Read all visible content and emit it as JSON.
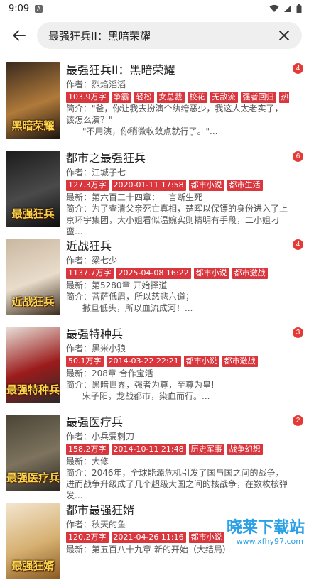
{
  "status_bar": {
    "time": "9:09",
    "notif_icon": "A"
  },
  "search": {
    "query": "最强狂兵II：黑暗荣耀"
  },
  "books": [
    {
      "title": "最强狂兵II：黑暗荣耀",
      "author": "作者：烈焰滔滔",
      "tags": [
        "103.9万字",
        "争霸",
        "轻松",
        "女总裁",
        "校花",
        "无敌流",
        "强者回归",
        "热"
      ],
      "line1": "简介：\"爸，你让我去扮演个纨绔恶少，我这人太老实了，该怎么演？\"",
      "line2": "\"不用演，你稍微收敛点就行了。\"...",
      "badge": "4",
      "cover_text": "黑暗荣耀",
      "cover_colors": [
        "#3b2a1e",
        "#b07a3a",
        "#1a1410"
      ]
    },
    {
      "title": "都市之最强狂兵",
      "author": "作者：江城子七",
      "tags": [
        "127.3万字",
        "2020-01-11 17:58",
        "都市小说",
        "都市生活"
      ],
      "line1": "最新：第六百三十四章：一言断生死",
      "line2": "简介：为了查清父亲死亡真相，楚晖以保镖的身份进入了上京环宇集团，大小姐看似温婉实则精明有手段，二小姐刁蛮...",
      "badge": "6",
      "cover_text": "最强狂兵",
      "cover_colors": [
        "#1b1b1b",
        "#4a4a4a",
        "#0d0d0d"
      ]
    },
    {
      "title": "近战狂兵",
      "author": "作者：梁七少",
      "tags": [
        "1137.7万字",
        "2025-04-08 16:22",
        "都市小说",
        "都市激战"
      ],
      "line1": "最新：第5280章 开始择道",
      "line2": "简介：菩萨低眉，所以慈悲六道；",
      "line3": "撒旦低头，所以血流成河！...",
      "badge": "4",
      "cover_text": "近战狂兵",
      "cover_colors": [
        "#c9b7a0",
        "#e9dccb",
        "#3a2a1a"
      ]
    },
    {
      "title": "最强特种兵",
      "author": "作者：黑米小狼",
      "tags": [
        "50.1万字",
        "2014-03-22 22:21",
        "都市小说",
        "都市激战"
      ],
      "line1": "最新：208章 合作宝活",
      "line2": "简介：黑暗世界，强者为尊，至尊为皇!",
      "line3": "宋子阳，龙战都市，染血而行。...",
      "badge": "3",
      "cover_text": "最强特种兵",
      "cover_colors": [
        "#e8e2da",
        "#9b1b1b",
        "#2a2a2a"
      ]
    },
    {
      "title": "最强医疗兵",
      "author": "作者：小兵爱刺刀",
      "tags": [
        "158.2万字",
        "2014-10-11 21:48",
        "历史军事",
        "战争幻想"
      ],
      "line1": "最新：大修",
      "line2": "简介：2046年，全球能源危机引发了国与国之间的战争，进而战争升级成了几个超级大国之间的核战争，在数枚核弹发...",
      "badge": "2",
      "cover_text": "最强医疗兵",
      "cover_colors": [
        "#4a4436",
        "#7d735e",
        "#2b2720"
      ]
    },
    {
      "title": "都市最强狂婿",
      "author": "作者：秋天的鱼",
      "tags": [
        "120.2万字",
        "2021-04-26 11:16",
        "都市小说"
      ],
      "line1": "最新：第五百八十九章 新的开始（大结局）",
      "line2": "",
      "badge": "",
      "cover_text": "最强狂婿",
      "cover_colors": [
        "#f3e6d0",
        "#d6b071",
        "#8a5a20"
      ]
    }
  ],
  "watermark": {
    "text": "晓莱下载站",
    "url": "www.xfhy97.com"
  }
}
